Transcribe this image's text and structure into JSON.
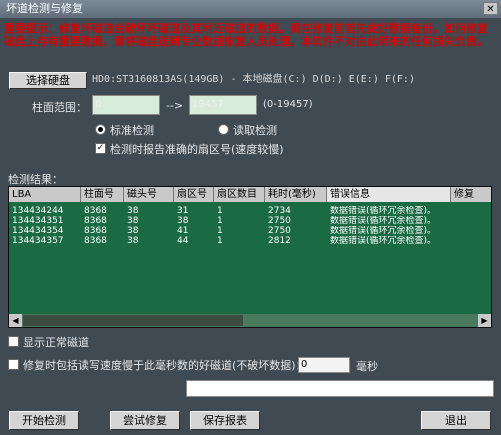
{
  "window": {
    "title": "坏道检测与修复",
    "close_glyph": "✕"
  },
  "notice": "重要提示：修复坏磁道会破坏坏磁道及其附近磁道的数据。请在修复前首先做好数据备份。如何修复磁盘上存有重要数据，请将磁盘送到专业数据恢复人员处理。本软件不对由此带来的任何损失负责。",
  "disk": {
    "select_label": "选择硬盘",
    "info": "HD0:ST3160813AS(149GB) - 本地磁盘(C:) D(D:) E(E:) F(F:)"
  },
  "range": {
    "label": "柱面范围：",
    "from": "0",
    "arrow": "-->",
    "to": "19457",
    "hint": "(0-19457)"
  },
  "options": {
    "standard_label": "标准检测",
    "read_label": "读取检测",
    "report_label": "检测时报告准确的扇区号(速度较慢)"
  },
  "results": {
    "label": "检测结果：",
    "columns": [
      "LBA",
      "柱面号",
      "磁头号",
      "扇区号",
      "扇区数目",
      "耗时(毫秒)",
      "错误信息",
      "修复"
    ],
    "rows": [
      [
        "134434244",
        "8368",
        "38",
        "31",
        "1",
        "2734",
        "数据错误(循环冗余检查)。",
        ""
      ],
      [
        "134434351",
        "8368",
        "38",
        "38",
        "1",
        "2750",
        "数据错误(循环冗余检查)。",
        ""
      ],
      [
        "134434354",
        "8368",
        "38",
        "41",
        "1",
        "2750",
        "数据错误(循环冗余检查)。",
        ""
      ],
      [
        "134434357",
        "8368",
        "38",
        "44",
        "1",
        "2812",
        "数据错误(循环冗余检查)。",
        ""
      ]
    ]
  },
  "show_normal_label": "显示正常磁道",
  "repair_slow": {
    "label": "修复时包括读写速度慢于此毫秒数的好磁道(不破坏数据)：",
    "value": "0",
    "unit": "毫秒"
  },
  "buttons": {
    "start": "开始检测",
    "try_repair": "尝试修复",
    "save_report": "保存报表",
    "exit": "退出"
  }
}
